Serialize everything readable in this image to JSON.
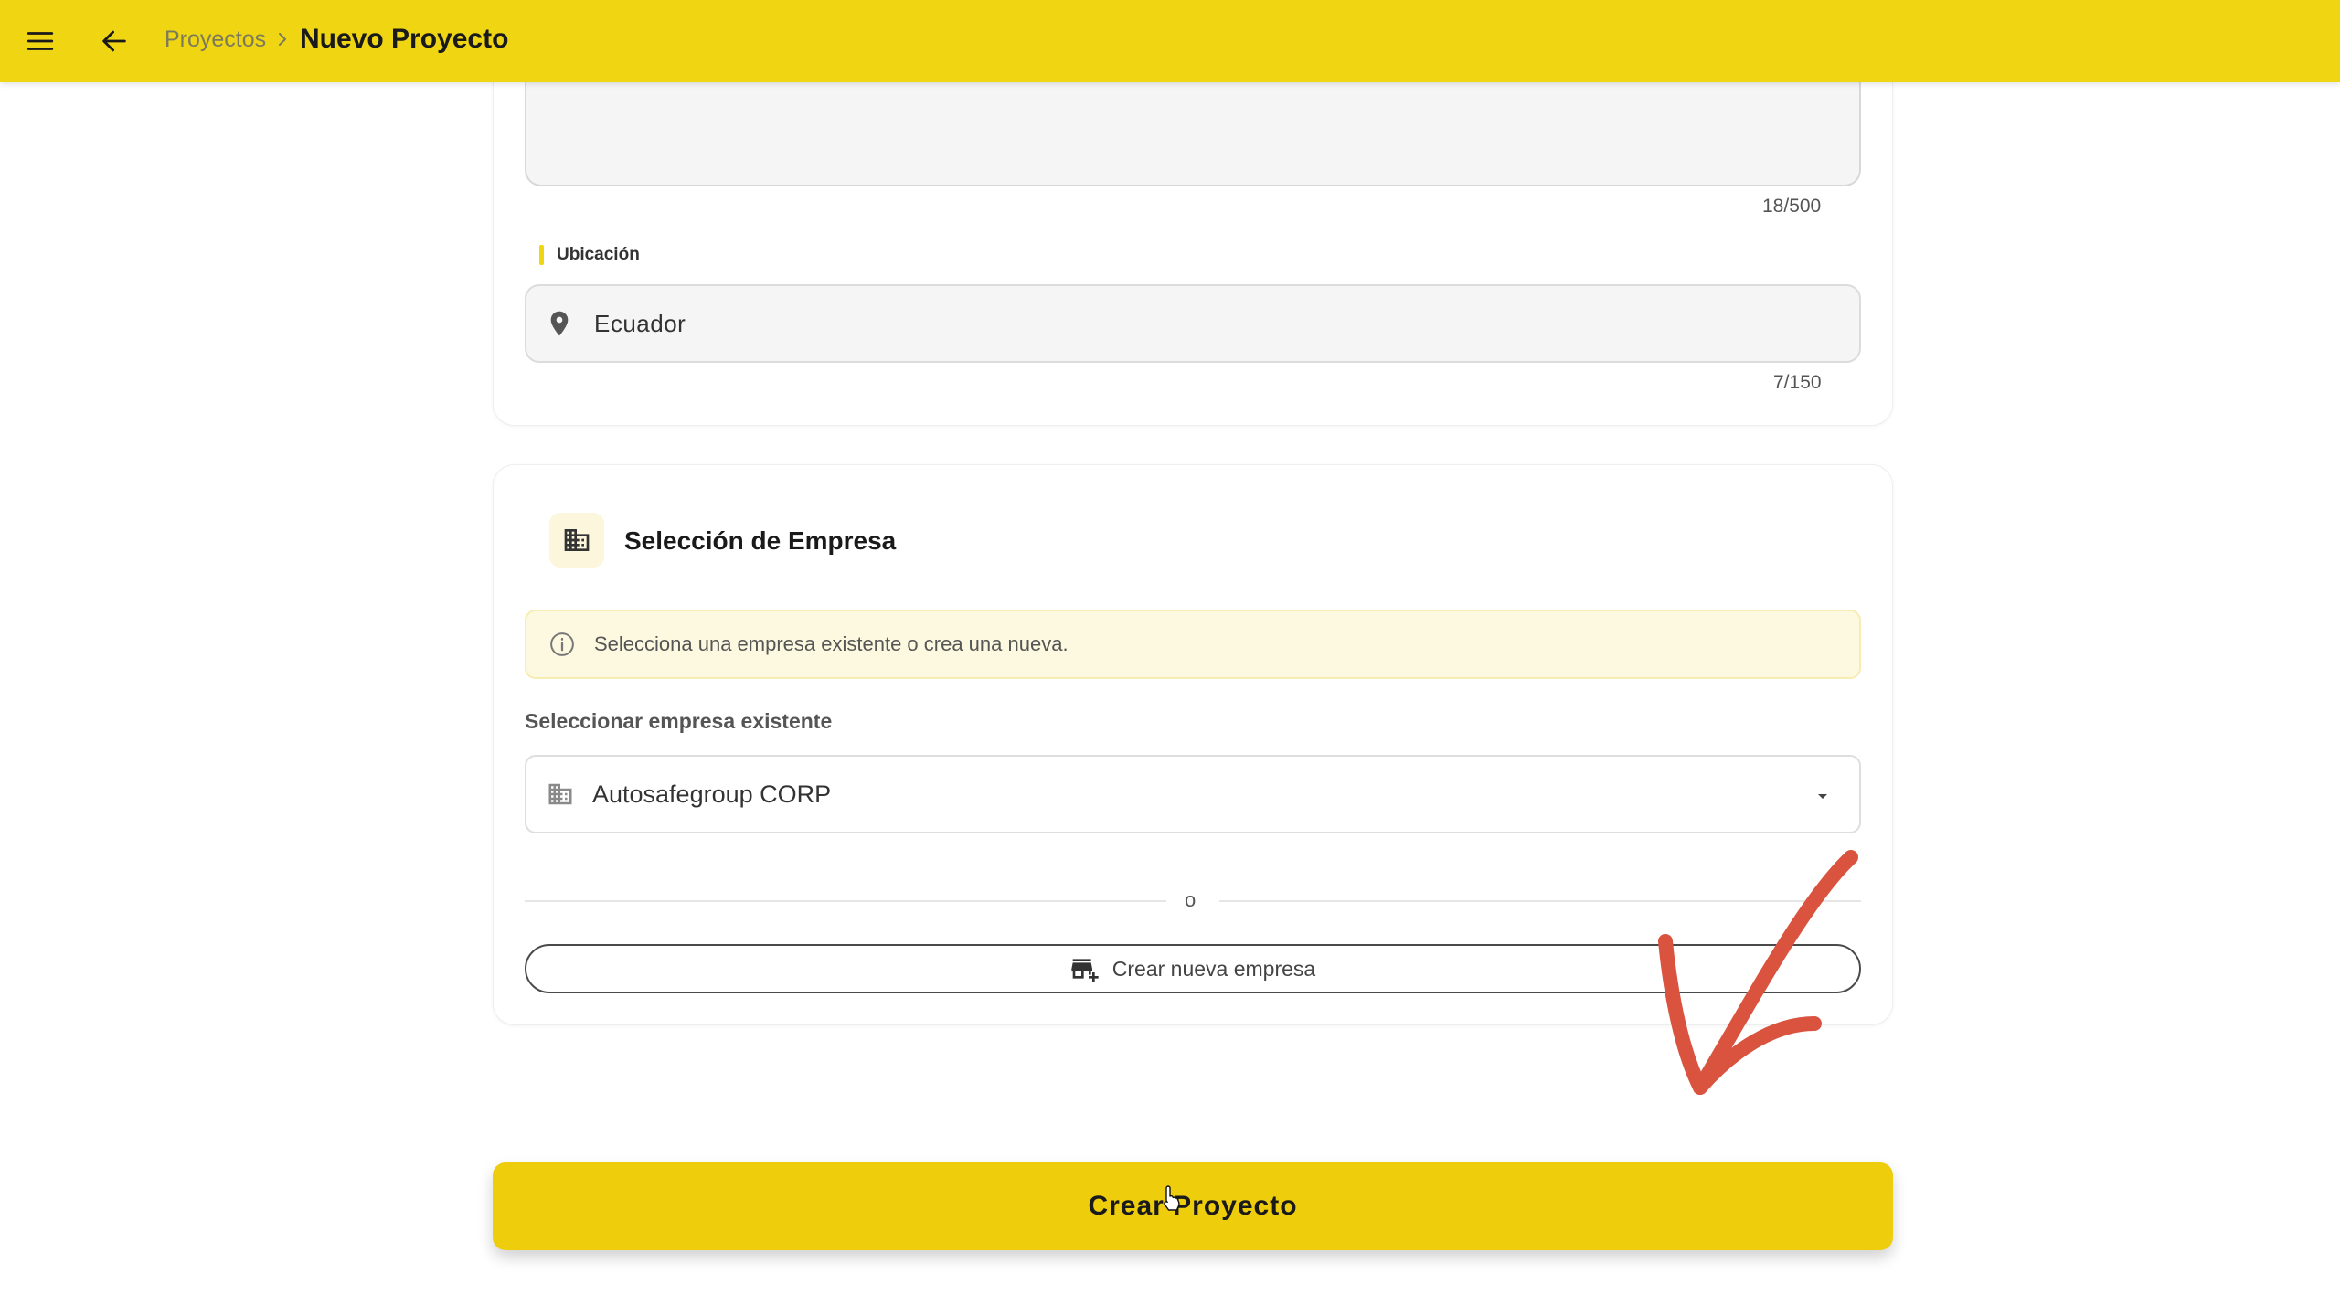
{
  "header": {
    "breadcrumb_parent": "Proyectos",
    "title": "Nuevo Proyecto",
    "background_color": "#f0d612"
  },
  "description_field": {
    "counter": "18/500"
  },
  "location_field": {
    "label": "Ubicación",
    "value": "Ecuador",
    "counter": "7/150",
    "icon": "location-pin-icon"
  },
  "company_section": {
    "title": "Selección de Empresa",
    "icon": "business-icon",
    "info_text": "Selecciona una empresa existente o crea una nueva.",
    "select_label": "Seleccionar empresa existente",
    "selected_company": "Autosafegroup CORP",
    "divider_text": "o",
    "create_button_label": "Crear nueva empresa"
  },
  "primary_button": {
    "label": "Crear Proyecto",
    "color": "#eecd0c"
  },
  "annotation": {
    "arrow_color": "#d9533f"
  }
}
